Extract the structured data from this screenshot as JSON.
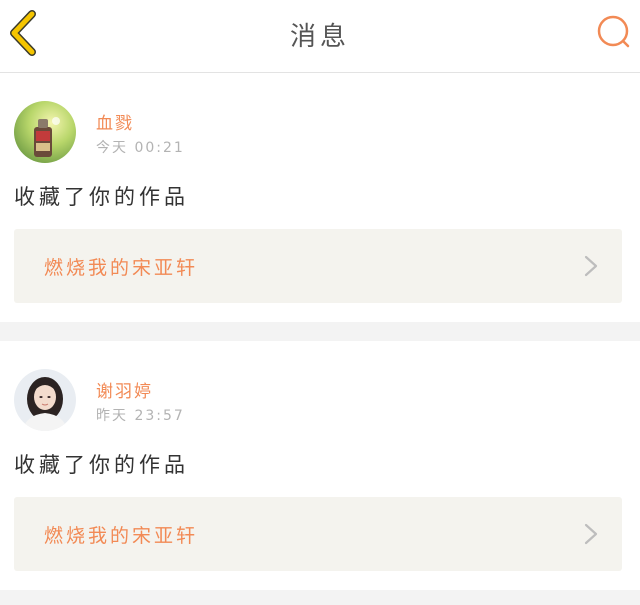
{
  "header": {
    "title": "消息",
    "back_icon": "chevron-left-icon",
    "search_icon": "search-icon",
    "back_color": "#f5c500",
    "search_color": "#f28a55"
  },
  "messages": [
    {
      "user": "血戮",
      "time": "今天 00:21",
      "action": "收藏了你的作品",
      "work_title": "燃烧我的宋亚轩"
    },
    {
      "user": "谢羽婷",
      "time": "昨天 23:57",
      "action": "收藏了你的作品",
      "work_title": "燃烧我的宋亚轩"
    }
  ],
  "colors": {
    "accent": "#f28a55",
    "card_bg": "#ffffff",
    "link_bg": "#f4f3ee",
    "page_bg": "#f3f3f3"
  }
}
